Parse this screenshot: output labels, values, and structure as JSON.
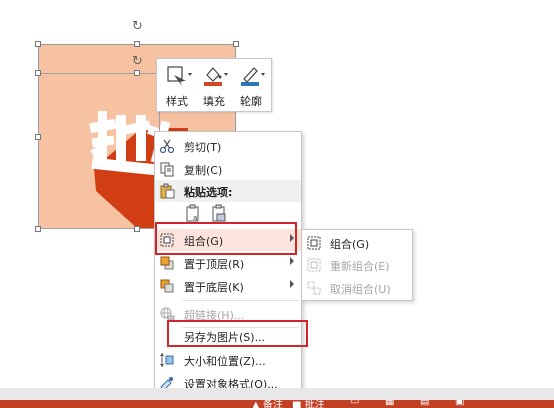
{
  "mini_toolbar": {
    "style_label": "样式",
    "fill_label": "填充",
    "outline_label": "轮廓"
  },
  "slide": {
    "bg_color": "#f6c2a2",
    "char_color": "#ffffff",
    "shadow_color": "#d13e14"
  },
  "context_menu": {
    "cut": "剪切(T)",
    "copy": "复制(C)",
    "paste_options": "粘贴选项:",
    "group": "组合(G)",
    "bring_to_front": "置于顶层(R)",
    "send_to_back": "置于底层(K)",
    "hyperlink": "超链接(H)...",
    "save_as_picture": "另存为图片(S)...",
    "size_position": "大小和位置(Z)...",
    "format_object": "设置对象格式(O)..."
  },
  "submenu": {
    "group": "组合(G)",
    "regroup": "重新组合(E)",
    "ungroup": "取消组合(U)"
  },
  "status_bar": {
    "notes": "备注",
    "comments": "批注"
  },
  "colors": {
    "highlight_border": "#d0262b",
    "highlight_bg": "#fce4dc",
    "status_bar": "#c24125"
  }
}
